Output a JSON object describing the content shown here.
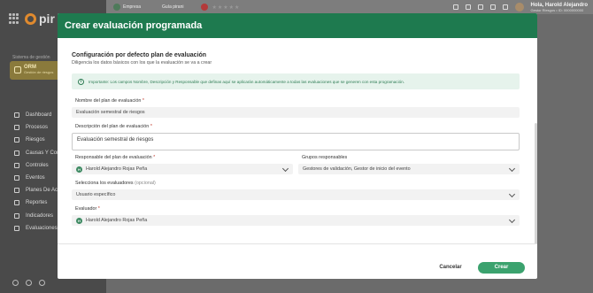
{
  "app": {
    "logo_text": "pir",
    "system_label": "Sistema de gestión",
    "system_card": {
      "title": "ORM",
      "subtitle": "Gestión de riesgos"
    },
    "menu": [
      {
        "label": "Dashboard",
        "icon": "dashboard-icon"
      },
      {
        "label": "Procesos",
        "icon": "list-icon"
      },
      {
        "label": "Riesgos",
        "icon": "warning-icon"
      },
      {
        "label": "Causas Y Con...",
        "icon": "link-icon"
      },
      {
        "label": "Controles",
        "icon": "sliders-icon"
      },
      {
        "label": "Eventos",
        "icon": "alert-icon"
      },
      {
        "label": "Planes De Acc...",
        "icon": "document-icon"
      },
      {
        "label": "Reportes",
        "icon": "report-icon"
      },
      {
        "label": "Indicadores",
        "icon": "gauge-icon"
      },
      {
        "label": "Evaluaciones",
        "icon": "checklist-icon"
      }
    ],
    "topbar": {
      "company_name": "Empresa",
      "company_sub": "ORM | ORM registro",
      "guide_label": "Guía pirani",
      "user_greeting": "Hola, Harold Alejandro",
      "user_role": "Gestor Riesgos • ID: 0000000000"
    }
  },
  "modal": {
    "title": "Crear evaluación programada",
    "section_title": "Configuración por defecto plan de evaluación",
    "section_subtitle": "Diligencia los datos básicos con los que la evaluación se va a crear",
    "info_text": "Importante: Los campos Nombre, Descripción y Responsable que definas aquí se aplicarán automáticamente a todas las evaluaciones que se generen con esta programación.",
    "fields": {
      "name": {
        "label": "Nombre del plan de evaluación",
        "value": "Evaluación semestral de riesgos"
      },
      "description": {
        "label": "Descripción del plan de evaluación",
        "value": "Evaluación semestral de riesgos"
      },
      "responsible": {
        "label": "Responsable del plan de evaluación",
        "value": "Harold Alejandro Rojas Peña",
        "initial": "H"
      },
      "groups": {
        "label": "Grupos responsables",
        "value": "Gestores de validación, Gestor de inicio del evento"
      },
      "evaluators_type": {
        "label": "Selecciona los evaluadores",
        "optional": "(opcional)",
        "value": "Usuario específico"
      },
      "evaluator": {
        "label": "Evaluador",
        "value": "Harold Alejandro Rojas Peña",
        "initial": "H"
      }
    },
    "required_mark": "*",
    "cancel_label": "Cancelar",
    "create_label": "Crear"
  },
  "colors": {
    "header": "#1e7a4f",
    "primary_button": "#3ba26e",
    "info_bg": "#e6f3ec"
  }
}
